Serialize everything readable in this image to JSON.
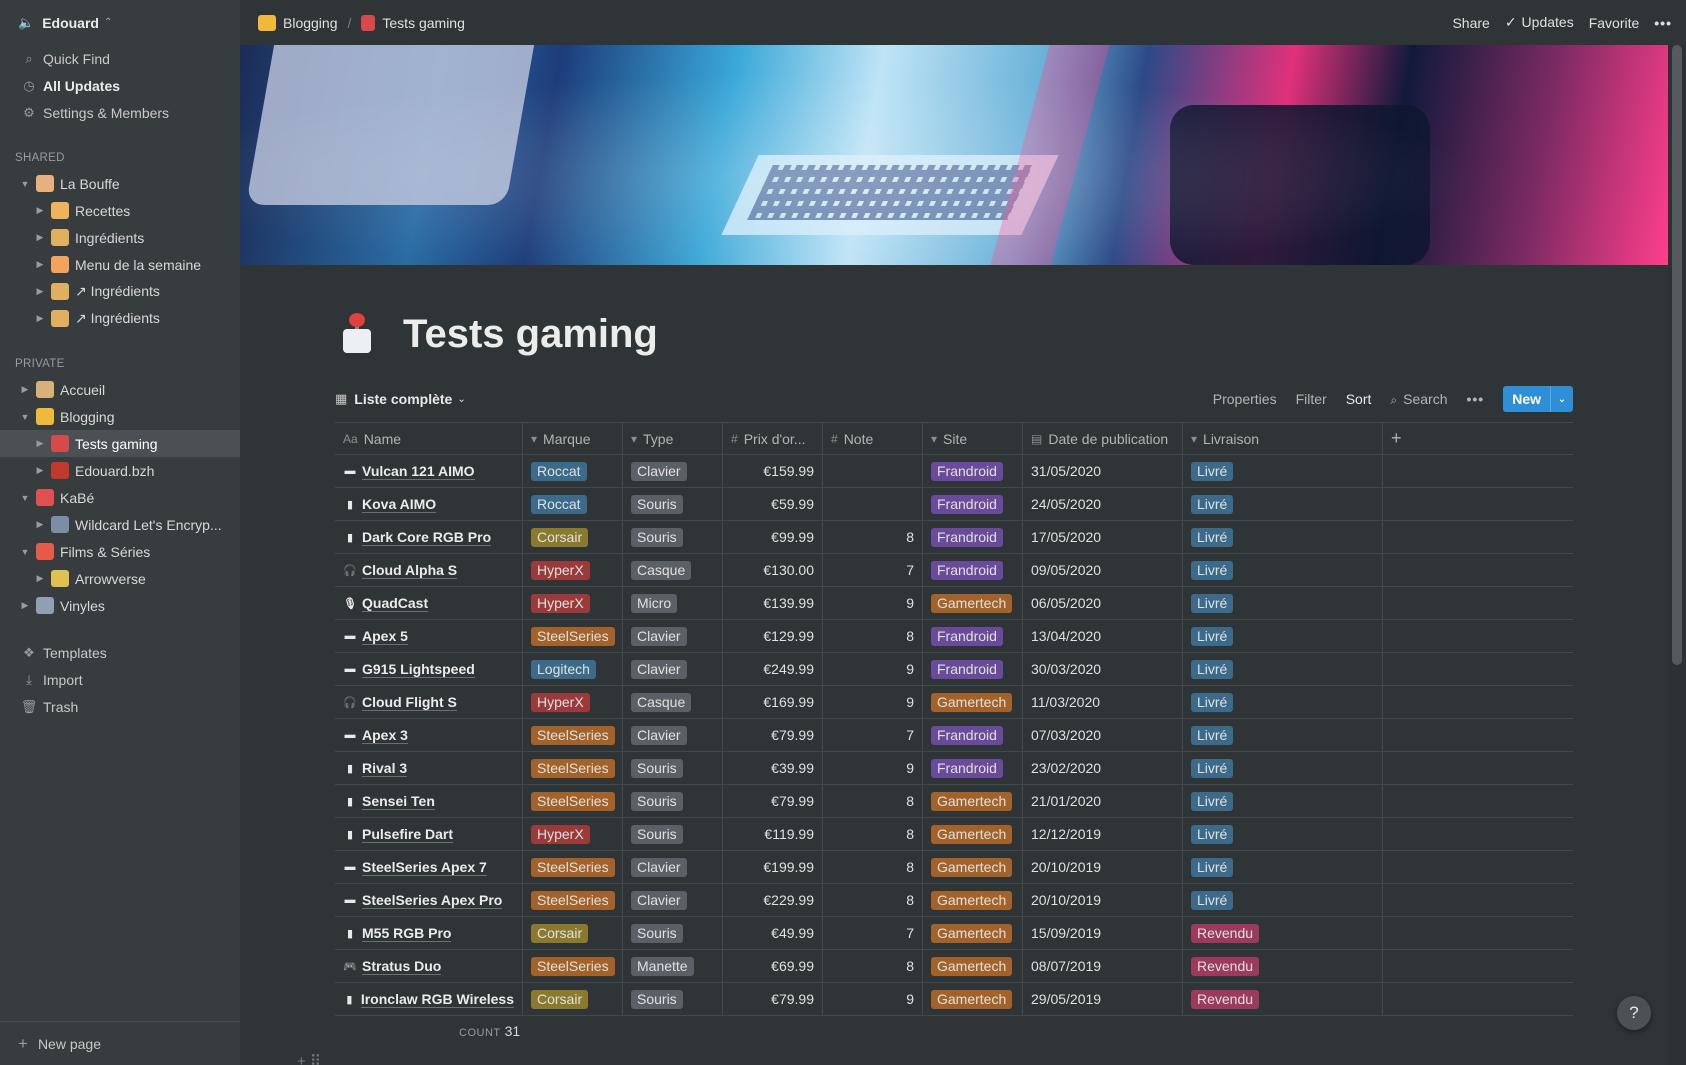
{
  "workspace": {
    "name": "Edouard",
    "icon": "speaker-icon"
  },
  "sidebar": {
    "nav": [
      {
        "label": "Quick Find",
        "icon": "search-icon"
      },
      {
        "label": "All Updates",
        "icon": "clock-icon"
      },
      {
        "label": "Settings & Members",
        "icon": "gear-icon"
      }
    ],
    "shared_label": "SHARED",
    "shared": [
      {
        "label": "La Bouffe",
        "level": 0,
        "open": true,
        "color": "#e8b07c"
      },
      {
        "label": "Recettes",
        "level": 1,
        "open": false,
        "color": "#f0b35b"
      },
      {
        "label": "Ingrédients",
        "level": 1,
        "open": false,
        "color": "#e0b060"
      },
      {
        "label": "Menu de la semaine",
        "level": 1,
        "open": false,
        "color": "#f3a35a"
      },
      {
        "label": "↗ Ingrédients",
        "level": 1,
        "open": false,
        "color": "#e0b060"
      },
      {
        "label": "↗ Ingrédients",
        "level": 1,
        "open": false,
        "color": "#e0b060"
      }
    ],
    "private_label": "PRIVATE",
    "private": [
      {
        "label": "Accueil",
        "level": 0,
        "open": false,
        "color": "#d8b07a"
      },
      {
        "label": "Blogging",
        "level": 0,
        "open": true,
        "color": "#f0b93a"
      },
      {
        "label": "Tests gaming",
        "level": 1,
        "open": false,
        "color": "#d84a4a",
        "active": true
      },
      {
        "label": "Edouard.bzh",
        "level": 1,
        "open": false,
        "color": "#c0392b"
      },
      {
        "label": "KaBé",
        "level": 0,
        "open": true,
        "color": "#e05050"
      },
      {
        "label": "Wildcard Let's Encryp...",
        "level": 1,
        "open": false,
        "color": "#7a8fa6"
      },
      {
        "label": "Films & Séries",
        "level": 0,
        "open": true,
        "color": "#e55a4a"
      },
      {
        "label": "Arrowverse",
        "level": 1,
        "open": false,
        "color": "#e0c050"
      },
      {
        "label": "Vinyles",
        "level": 0,
        "open": false,
        "color": "#8fa0b5"
      }
    ],
    "bottom": [
      {
        "label": "Templates",
        "icon": "templates-icon"
      },
      {
        "label": "Import",
        "icon": "import-icon"
      },
      {
        "label": "Trash",
        "icon": "trash-icon"
      }
    ],
    "new_page": "New page"
  },
  "topbar": {
    "breadcrumb": [
      "Blogging",
      "Tests gaming"
    ],
    "share": "Share",
    "updates": "Updates",
    "favorite": "Favorite",
    "more": "•••"
  },
  "page": {
    "title": "Tests gaming",
    "view_name": "Liste complète",
    "view_actions": {
      "properties": "Properties",
      "filter": "Filter",
      "sort": "Sort",
      "search": "Search",
      "more": "•••",
      "new": "New"
    }
  },
  "columns": [
    {
      "key": "name",
      "label": "Name",
      "icon": "Aa"
    },
    {
      "key": "marque",
      "label": "Marque",
      "icon": "▾"
    },
    {
      "key": "type",
      "label": "Type",
      "icon": "▾"
    },
    {
      "key": "prix",
      "label": "Prix d'or...",
      "icon": "#"
    },
    {
      "key": "note",
      "label": "Note",
      "icon": "#"
    },
    {
      "key": "site",
      "label": "Site",
      "icon": "▾"
    },
    {
      "key": "date",
      "label": "Date de publication",
      "icon": "▤"
    },
    {
      "key": "livraison",
      "label": "Livraison",
      "icon": "▾"
    }
  ],
  "tag_colors": {
    "Roccat": "#3b6a8a",
    "Corsair": "#8a7a2e",
    "HyperX": "#9b3a3a",
    "SteelSeries": "#a3622a",
    "Logitech": "#3b6a8a",
    "Clavier": "#5a6166",
    "Souris": "#5a6166",
    "Casque": "#5a6166",
    "Micro": "#5a6166",
    "Manette": "#5a6166",
    "Frandroid": "#6a4a9a",
    "Gamertech": "#a3622a",
    "Livré": "#3b6a8a",
    "Revendu": "#9b3a5c"
  },
  "rows": [
    {
      "icon": "keyboard",
      "name": "Vulcan 121 AIMO",
      "marque": "Roccat",
      "type": "Clavier",
      "prix": "€159.99",
      "note": "",
      "site": "Frandroid",
      "date": "31/05/2020",
      "livraison": "Livré"
    },
    {
      "icon": "mouse",
      "name": "Kova AIMO",
      "marque": "Roccat",
      "type": "Souris",
      "prix": "€59.99",
      "note": "",
      "site": "Frandroid",
      "date": "24/05/2020",
      "livraison": "Livré"
    },
    {
      "icon": "mouse",
      "name": "Dark Core RGB Pro",
      "marque": "Corsair",
      "type": "Souris",
      "prix": "€99.99",
      "note": "8",
      "site": "Frandroid",
      "date": "17/05/2020",
      "livraison": "Livré"
    },
    {
      "icon": "headphones",
      "name": "Cloud Alpha S",
      "marque": "HyperX",
      "type": "Casque",
      "prix": "€130.00",
      "note": "7",
      "site": "Frandroid",
      "date": "09/05/2020",
      "livraison": "Livré"
    },
    {
      "icon": "mic",
      "name": "QuadCast",
      "marque": "HyperX",
      "type": "Micro",
      "prix": "€139.99",
      "note": "9",
      "site": "Gamertech",
      "date": "06/05/2020",
      "livraison": "Livré"
    },
    {
      "icon": "keyboard",
      "name": "Apex 5",
      "marque": "SteelSeries",
      "type": "Clavier",
      "prix": "€129.99",
      "note": "8",
      "site": "Frandroid",
      "date": "13/04/2020",
      "livraison": "Livré"
    },
    {
      "icon": "keyboard",
      "name": "G915 Lightspeed",
      "marque": "Logitech",
      "type": "Clavier",
      "prix": "€249.99",
      "note": "9",
      "site": "Frandroid",
      "date": "30/03/2020",
      "livraison": "Livré"
    },
    {
      "icon": "headphones",
      "name": "Cloud Flight S",
      "marque": "HyperX",
      "type": "Casque",
      "prix": "€169.99",
      "note": "9",
      "site": "Gamertech",
      "date": "11/03/2020",
      "livraison": "Livré"
    },
    {
      "icon": "keyboard",
      "name": "Apex 3",
      "marque": "SteelSeries",
      "type": "Clavier",
      "prix": "€79.99",
      "note": "7",
      "site": "Frandroid",
      "date": "07/03/2020",
      "livraison": "Livré"
    },
    {
      "icon": "mouse",
      "name": "Rival 3",
      "marque": "SteelSeries",
      "type": "Souris",
      "prix": "€39.99",
      "note": "9",
      "site": "Frandroid",
      "date": "23/02/2020",
      "livraison": "Livré"
    },
    {
      "icon": "mouse",
      "name": "Sensei Ten",
      "marque": "SteelSeries",
      "type": "Souris",
      "prix": "€79.99",
      "note": "8",
      "site": "Gamertech",
      "date": "21/01/2020",
      "livraison": "Livré"
    },
    {
      "icon": "mouse",
      "name": "Pulsefire Dart",
      "marque": "HyperX",
      "type": "Souris",
      "prix": "€119.99",
      "note": "8",
      "site": "Gamertech",
      "date": "12/12/2019",
      "livraison": "Livré"
    },
    {
      "icon": "keyboard",
      "name": "SteelSeries Apex 7",
      "marque": "SteelSeries",
      "type": "Clavier",
      "prix": "€199.99",
      "note": "8",
      "site": "Gamertech",
      "date": "20/10/2019",
      "livraison": "Livré"
    },
    {
      "icon": "keyboard",
      "name": "SteelSeries Apex Pro",
      "marque": "SteelSeries",
      "type": "Clavier",
      "prix": "€229.99",
      "note": "8",
      "site": "Gamertech",
      "date": "20/10/2019",
      "livraison": "Livré"
    },
    {
      "icon": "mouse",
      "name": "M55 RGB Pro",
      "marque": "Corsair",
      "type": "Souris",
      "prix": "€49.99",
      "note": "7",
      "site": "Gamertech",
      "date": "15/09/2019",
      "livraison": "Revendu"
    },
    {
      "icon": "gamepad",
      "name": "Stratus Duo",
      "marque": "SteelSeries",
      "type": "Manette",
      "prix": "€69.99",
      "note": "8",
      "site": "Gamertech",
      "date": "08/07/2019",
      "livraison": "Revendu"
    },
    {
      "icon": "mouse",
      "name": "Ironclaw RGB Wireless",
      "marque": "Corsair",
      "type": "Souris",
      "prix": "€79.99",
      "note": "9",
      "site": "Gamertech",
      "date": "29/05/2019",
      "livraison": "Revendu"
    }
  ],
  "count": {
    "label": "COUNT",
    "value": "31"
  },
  "help": "?"
}
